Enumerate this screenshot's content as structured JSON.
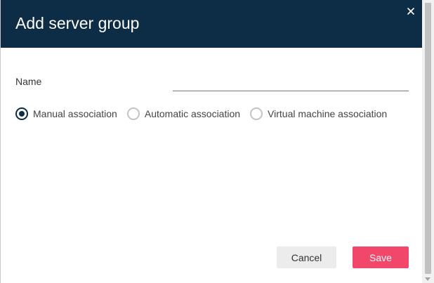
{
  "dialog": {
    "title": "Add server group",
    "close_label": "×"
  },
  "form": {
    "name_label": "Name",
    "name_value": "",
    "name_placeholder": ""
  },
  "association": {
    "selected": "manual",
    "options": [
      {
        "id": "manual",
        "label": "Manual association",
        "checked": true
      },
      {
        "id": "automatic",
        "label": "Automatic association",
        "checked": false
      },
      {
        "id": "virtual",
        "label": "Virtual machine association",
        "checked": false
      }
    ]
  },
  "actions": {
    "cancel_label": "Cancel",
    "save_label": "Save"
  },
  "colors": {
    "header_bg": "#0d2d47",
    "save_bg": "#f0476b",
    "cancel_bg": "#ececec",
    "radio_checked": "#0d2d47"
  }
}
